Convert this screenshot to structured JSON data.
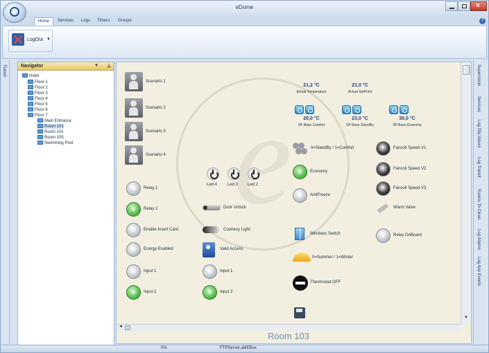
{
  "window": {
    "title": "eDome"
  },
  "ribbon_tabs": [
    "Home",
    "Services",
    "Logs",
    "Timers",
    "Groups"
  ],
  "ribbon": {
    "logout_label": "LogOut"
  },
  "left_strip": {
    "label": "Transit"
  },
  "navigator": {
    "title": "Navigator",
    "tree": [
      "Hotel",
      "Floor 1",
      "Floor 2",
      "Floor 3",
      "Floor 4",
      "Floor 5",
      "Floor 6",
      "Floor 7",
      "Main Entrance",
      "Room 101",
      "Room 10x",
      "Room 105",
      "Swimming Pool"
    ]
  },
  "scenarios": [
    "Scenario 1",
    "Scenario 2",
    "Scenario 3",
    "Scenario 4"
  ],
  "temperatures": [
    {
      "value": "21,2 °C",
      "label": "Actual Temperature"
    },
    {
      "value": "21,0 °C",
      "label": "Actual SetPoint"
    }
  ],
  "setpoints": [
    {
      "value": "20,0 °C",
      "label": "SP Base Comfort"
    },
    {
      "value": "23,0 °C",
      "label": "SP Base StandBy"
    },
    {
      "value": "30,0 °C",
      "label": "SP Base Economy"
    }
  ],
  "leds": [
    "Led 4",
    "Led 3",
    "Led 2"
  ],
  "col1_controls": [
    "Relay 1",
    "Relay 2",
    "Enable Insert Card",
    "Energy Enabled",
    "Input 1",
    "Input 2"
  ],
  "col2_controls": [
    "Door Unlock",
    "Courtesy Light",
    "Valid Access",
    "Input 1",
    "Input 2"
  ],
  "col3_controls": [
    "0=StandBy / 1=Comfort",
    "Economy",
    "AntiFreeze",
    "Windows Switch",
    "0=Summer / 1=Winter",
    "Thermostat OFF"
  ],
  "col4_controls": [
    "Fancoil Speed V1",
    "Fancoil Speed V2",
    "Fancoil Speed V3",
    "Warm Valve",
    "Relay OnBoard"
  ],
  "room": {
    "label": "Room 103"
  },
  "right_tabs": [
    "Supervision",
    "Services",
    "Log Obj Values",
    "Log Transit",
    "Rooms To Clean",
    "Log Alarms",
    "Log App Events"
  ],
  "status": {
    "progress": "0%",
    "server": "FTPServer.ablEBox"
  },
  "colors": {
    "accent": "#2f5ea8",
    "green_on": "#55b84a",
    "temp_blue": "#1f3f80"
  }
}
